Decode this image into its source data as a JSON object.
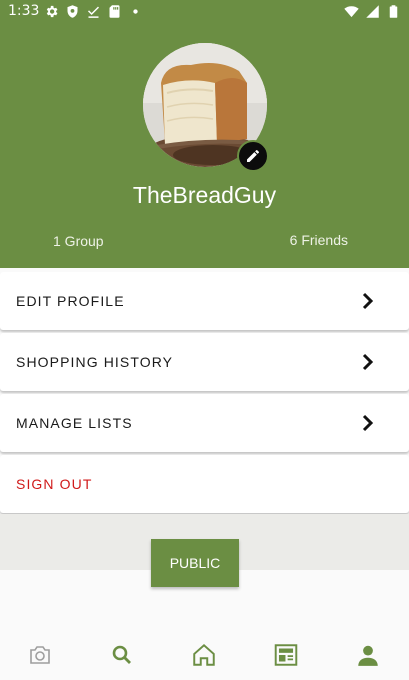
{
  "status_bar": {
    "time": "1:33",
    "left_icons": [
      "gear-icon",
      "shield-icon",
      "check-download-icon",
      "sd-card-icon",
      "dot-icon"
    ],
    "right_icons": [
      "wifi-icon",
      "signal-icon",
      "battery-icon"
    ]
  },
  "profile": {
    "username": "TheBreadGuy",
    "groups_label": "1 Group",
    "friends_label": "6 Friends",
    "avatar_icon": "bread-avatar",
    "edit_icon": "pencil-icon"
  },
  "menu": {
    "items": [
      {
        "label": "EDIT PROFILE"
      },
      {
        "label": "SHOPPING HISTORY"
      },
      {
        "label": "MANAGE LISTS"
      },
      {
        "label": "SIGN OUT"
      }
    ]
  },
  "visibility": {
    "button_label": "PUBLIC"
  },
  "bottom_nav": {
    "items": [
      {
        "icon": "camera-icon",
        "active": false
      },
      {
        "icon": "search-icon",
        "active": false
      },
      {
        "icon": "home-icon",
        "active": false
      },
      {
        "icon": "newspaper-icon",
        "active": false
      },
      {
        "icon": "person-icon",
        "active": true
      }
    ]
  },
  "colors": {
    "brand_green": "#6b8e43",
    "danger_red": "#d01a1a"
  }
}
